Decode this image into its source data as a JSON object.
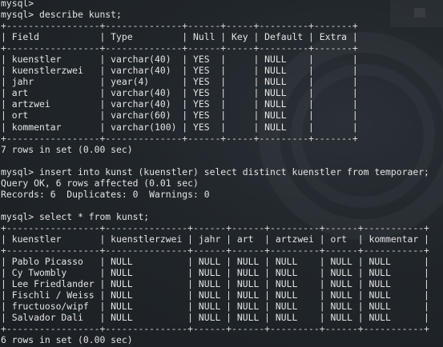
{
  "terminal": {
    "lines": [
      "mysql>",
      "mysql> describe kunst;",
      "+-----------------+--------------+------+-----+---------+-------+",
      "| Field           | Type         | Null | Key | Default | Extra |",
      "+-----------------+--------------+------+-----+---------+-------+",
      "| kuenstler       | varchar(40)  | YES  |     | NULL    |       |",
      "| kuenstlerzwei   | varchar(40)  | YES  |     | NULL    |       |",
      "| jahr            | year(4)      | YES  |     | NULL    |       |",
      "| art             | varchar(40)  | YES  |     | NULL    |       |",
      "| artzwei         | varchar(40)  | YES  |     | NULL    |       |",
      "| ort             | varchar(60)  | YES  |     | NULL    |       |",
      "| kommentar       | varchar(100) | YES  |     | NULL    |       |",
      "+-----------------+--------------+------+-----+---------+-------+",
      "7 rows in set (0.00 sec)",
      "",
      "mysql> insert into kunst (kuenstler) select distinct kuenstler from temporaer;",
      "Query OK, 6 rows affected (0.01 sec)",
      "Records: 6  Duplicates: 0  Warnings: 0",
      "",
      "mysql> select * from kunst;",
      "+-----------------+---------------+------+------+---------+------+-----------+",
      "| kuenstler       | kuenstlerzwei | jahr | art  | artzwei | ort  | kommentar |",
      "+-----------------+---------------+------+------+---------+------+-----------+",
      "| Pablo Picasso   | NULL          | NULL | NULL | NULL    | NULL | NULL      |",
      "| Cy Twombly      | NULL          | NULL | NULL | NULL    | NULL | NULL      |",
      "| Lee Friedlander | NULL          | NULL | NULL | NULL    | NULL | NULL      |",
      "| Fischli / Weiss | NULL          | NULL | NULL | NULL    | NULL | NULL      |",
      "| fructuoso/wipf  | NULL          | NULL | NULL | NULL    | NULL | NULL      |",
      "| Salvador Dali   | NULL          | NULL | NULL | NULL    | NULL | NULL      |",
      "+-----------------+---------------+------+------+---------+------+-----------+",
      "6 rows in set (0.00 sec)"
    ]
  }
}
